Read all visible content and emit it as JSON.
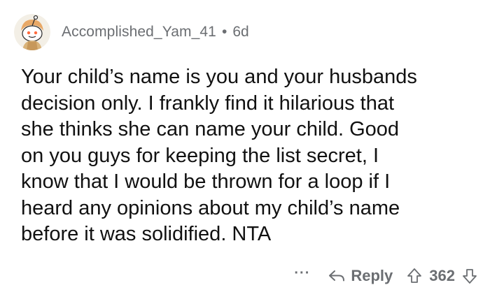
{
  "comment": {
    "author": "Accomplished_Yam_41",
    "separator": "•",
    "age": "6d",
    "avatar_icon": "snoo-avatar-icon",
    "body_lines": [
      "Your child’s name is you and your husbands",
      "decision only. I frankly find it hilarious that",
      "she thinks she can name your child. Good",
      "on you guys for keeping the list secret, I",
      "know that I would be thrown for a loop if I",
      "heard any opinions about my child’s name",
      "before it was solidified. NTA"
    ]
  },
  "actions": {
    "more_label": "···",
    "reply_icon": "reply-arrow-icon",
    "reply_label": "Reply",
    "upvote_icon": "upvote-arrow-icon",
    "score": "362",
    "downvote_icon": "downvote-arrow-icon"
  },
  "colors": {
    "meta_gray": "#6b6e72",
    "text": "#111111",
    "background": "#ffffff"
  }
}
